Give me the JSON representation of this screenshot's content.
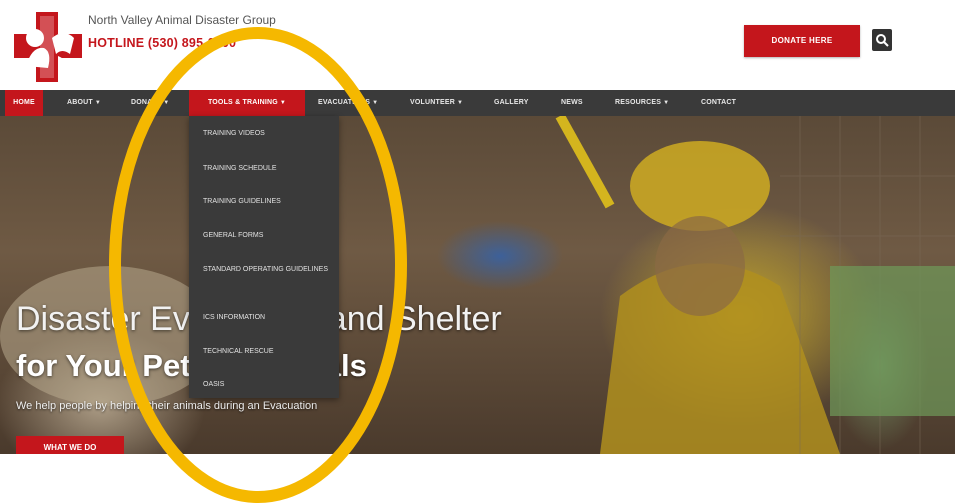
{
  "header": {
    "org_name": "North Valley Animal Disaster Group",
    "hotline": "HOTLINE (530) 895-0000",
    "donate_label": "DONATE HERE"
  },
  "nav": {
    "items": [
      {
        "label": "HOME",
        "dropdown": false,
        "active": true
      },
      {
        "label": "ABOUT",
        "dropdown": true,
        "active": false
      },
      {
        "label": "DONATE",
        "dropdown": true,
        "active": false
      },
      {
        "label": "TOOLS & TRAINING",
        "dropdown": true,
        "active": false,
        "highlighted": true
      },
      {
        "label": "EVACUATIONS",
        "dropdown": true,
        "active": false
      },
      {
        "label": "VOLUNTEER",
        "dropdown": true,
        "active": false
      },
      {
        "label": "GALLERY",
        "dropdown": false,
        "active": false
      },
      {
        "label": "NEWS",
        "dropdown": false,
        "active": false
      },
      {
        "label": "RESOURCES",
        "dropdown": true,
        "active": false
      },
      {
        "label": "CONTACT",
        "dropdown": false,
        "active": false
      }
    ]
  },
  "dropdown": {
    "items": [
      {
        "label": "TRAINING VIDEOS"
      },
      {
        "label": "TRAINING SCHEDULE"
      },
      {
        "label": "TRAINING GUIDELINES"
      },
      {
        "label": "GENERAL FORMS"
      },
      {
        "label": "STANDARD OPERATING GUIDELINES"
      },
      {
        "label": "ICS INFORMATION"
      },
      {
        "label": "TECHNICAL RESCUE"
      },
      {
        "label": "OASIS"
      }
    ]
  },
  "hero": {
    "headline": "Disaster Evacuation and Shelter",
    "subheadline": "for Your Pets & Animals",
    "tagline": "We help people by helping their animals during an Evacuation",
    "cta_label": "WHAT WE DO"
  },
  "colors": {
    "brand_red": "#c4161c",
    "nav_bg": "#3a3a3a",
    "annotation": "#f5b800"
  }
}
